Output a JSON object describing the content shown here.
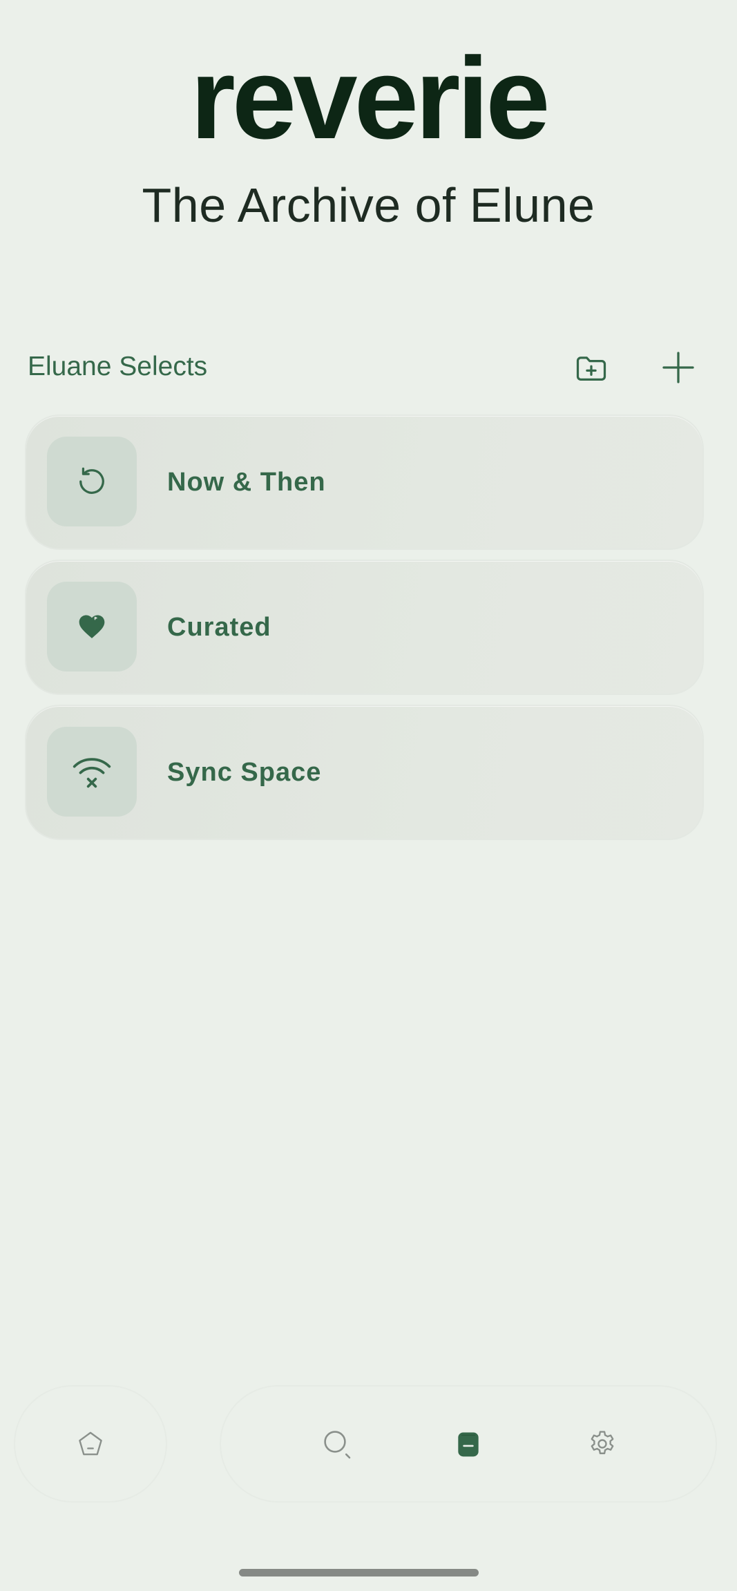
{
  "app": {
    "title": "reverie",
    "subtitle": "The Archive of Elune"
  },
  "section": {
    "title": "Eluane Selects",
    "actions": [
      {
        "icon": "folder-plus-icon"
      },
      {
        "icon": "plus-icon"
      }
    ]
  },
  "collections": [
    {
      "label": "Now & Then",
      "icon": "history-icon"
    },
    {
      "label": "Curated",
      "icon": "heart-icon"
    },
    {
      "label": "Sync Space",
      "icon": "wifi-off-icon"
    }
  ],
  "bottom_nav": {
    "items": [
      {
        "icon": "home-icon",
        "active": false
      },
      {
        "icon": "search-icon",
        "active": false
      },
      {
        "icon": "library-icon",
        "active": true
      },
      {
        "icon": "settings-icon",
        "active": false
      }
    ]
  },
  "colors": {
    "background": "#ebf0ea",
    "accent": "#35684a",
    "title": "#0d2615",
    "card": "#e1e6df",
    "icon_tile": "#cfdad1",
    "inactive_icon": "#8a908b"
  }
}
